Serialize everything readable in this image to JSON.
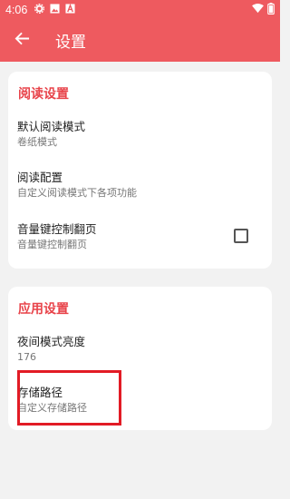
{
  "status_bar": {
    "time": "4:06",
    "icons": [
      "settings-icon",
      "image-icon",
      "font-icon",
      "wifi-icon",
      "battery-icon"
    ]
  },
  "app_bar": {
    "title": "设置",
    "back_icon": "arrow-back-icon"
  },
  "reading_settings": {
    "header": "阅读设置",
    "items": [
      {
        "title": "默认阅读模式",
        "summary": "卷纸模式"
      },
      {
        "title": "阅读配置",
        "summary": "自定义阅读模式下各项功能"
      },
      {
        "title": "音量键控制翻页",
        "summary": "音量键控制翻页",
        "checked": false
      }
    ]
  },
  "app_settings": {
    "header": "应用设置",
    "items": [
      {
        "title": "夜间模式亮度",
        "summary": "176"
      },
      {
        "title": "存储路径",
        "summary": "自定义存储路径"
      }
    ]
  },
  "colors": {
    "accent": "#ee5a5f",
    "section_title": "#e8434a",
    "highlight": "#e21b25"
  }
}
